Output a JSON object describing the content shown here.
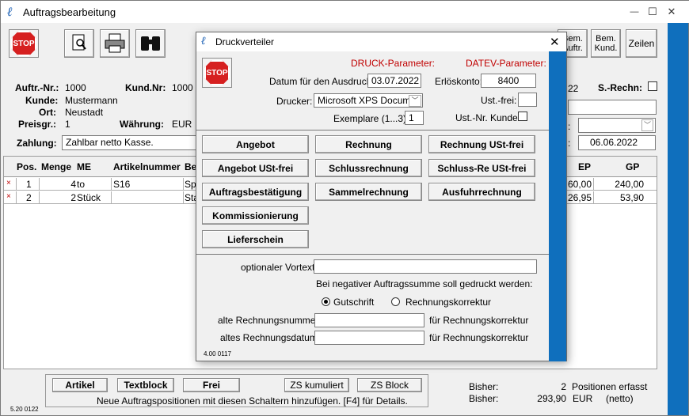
{
  "main": {
    "title": "Auftragsbearbeitung",
    "win_minimize": "—",
    "win_maximize": "☐",
    "win_close": "✕",
    "toolbar": {
      "stop_label": "STOP",
      "right_buttons": [
        "Bem. Auftr.",
        "Bem. Kund.",
        "Zeilen"
      ],
      "bem_auftr_l1": "Bem.",
      "bem_auftr_l2": "Auftr.",
      "bem_kund_l1": "Bem.",
      "bem_kund_l2": "Kund.",
      "zeilen": "Zeilen"
    },
    "header": {
      "auftr_nr_label": "Auftr.-Nr.:",
      "auftr_nr": "1000",
      "kund_nr_label": "Kund.Nr:",
      "kund_nr": "1000",
      "kunde_label": "Kunde:",
      "kunde": "Mustermann",
      "ort_label": "Ort:",
      "ort": "Neustadt",
      "preisgr_label": "Preisgr.:",
      "preisgr": "1",
      "waehrung_label": "Währung:",
      "waehrung": "EUR",
      "zahlung_label": "Zahlung:",
      "zahlung": "Zahlbar netto Kasse.",
      "s_rechn_label": "S.-Rechn:",
      "partial_22": "22",
      "date_value": "06.06.2022"
    },
    "table": {
      "headers": {
        "pos": "Pos.",
        "menge": "Menge",
        "me": "ME",
        "artikelnummer": "Artikelnummer",
        "be": "Be",
        "ep": "EP",
        "gp": "GP"
      },
      "rows": [
        {
          "x": "×",
          "pos": "1",
          "menge": "4",
          "me": "to",
          "artikelnummer": "S16",
          "be": "Sp",
          "ep": "60,00",
          "gp": "240,00"
        },
        {
          "x": "×",
          "pos": "2",
          "menge": "2",
          "me": "Stück",
          "artikelnummer": "",
          "be": "Sta",
          "ep": "26,95",
          "gp": "53,90"
        }
      ]
    },
    "footer": {
      "artikel": "Artikel",
      "textblock": "Textblock",
      "frei": "Frei",
      "zs_kumuliert": "ZS kumuliert",
      "zs_block": "ZS Block",
      "hint": "Neue Auftragspositionen mit diesen Schaltern hinzufügen. [F4] für Details.",
      "bisher1_label": "Bisher:",
      "bisher1_value": "2",
      "bisher1_text": "Positionen erfasst",
      "bisher2_label": "Bisher:",
      "bisher2_value": "293,90",
      "bisher2_currency": "EUR",
      "bisher2_note": "(netto)",
      "version": "5.20 0122"
    }
  },
  "dialog": {
    "title": "Druckverteiler",
    "close": "✕",
    "stop_label": "STOP",
    "druck_param": "DRUCK-Parameter:",
    "datev_param": "DATEV-Parameter:",
    "datum_label": "Datum für den Ausdruck:",
    "datum_value": "03.07.2022",
    "erloes_label": "Erlöskonto:",
    "erloes_value": "8400",
    "drucker_label": "Drucker:",
    "drucker_value": "Microsoft XPS Documen",
    "ust_frei_label": "Ust.-frei:",
    "exemplare_label": "Exemplare (1...3):",
    "exemplare_value": "1",
    "ust_nr_label": "Ust.-Nr. Kunde:",
    "buttons": {
      "angebot": "Angebot",
      "rechnung": "Rechnung",
      "rechnung_ust_frei": "Rechnung USt-frei",
      "angebot_ust_frei": "Angebot USt-frei",
      "schlussrechnung": "Schlussrechnung",
      "schluss_re_ust_frei": "Schluss-Re USt-frei",
      "auftragsbestaetigung": "Auftragsbestätigung",
      "sammelrechnung": "Sammelrechnung",
      "ausfuhrrechnung": "Ausfuhrrechnung",
      "kommissionierung": "Kommissionierung",
      "lieferschein": "Lieferschein"
    },
    "vortext_label": "optionaler Vortext:",
    "negativ_text": "Bei negativer Auftragssumme soll gedruckt werden:",
    "radio_gutschrift": "Gutschrift",
    "radio_korrektur": "Rechnungskorrektur",
    "alte_nr_label": "alte Rechnungsnummer:",
    "alte_nr_suffix": "für Rechnungskorrektur",
    "altes_datum_label": "altes Rechnungsdatum:",
    "altes_datum_suffix": "für Rechnungskorrektur",
    "version": "4.00 0117"
  },
  "colors": {
    "accent_blue": "#0f6fbd",
    "param_red": "#c00000",
    "stop_red": "#d62020"
  }
}
